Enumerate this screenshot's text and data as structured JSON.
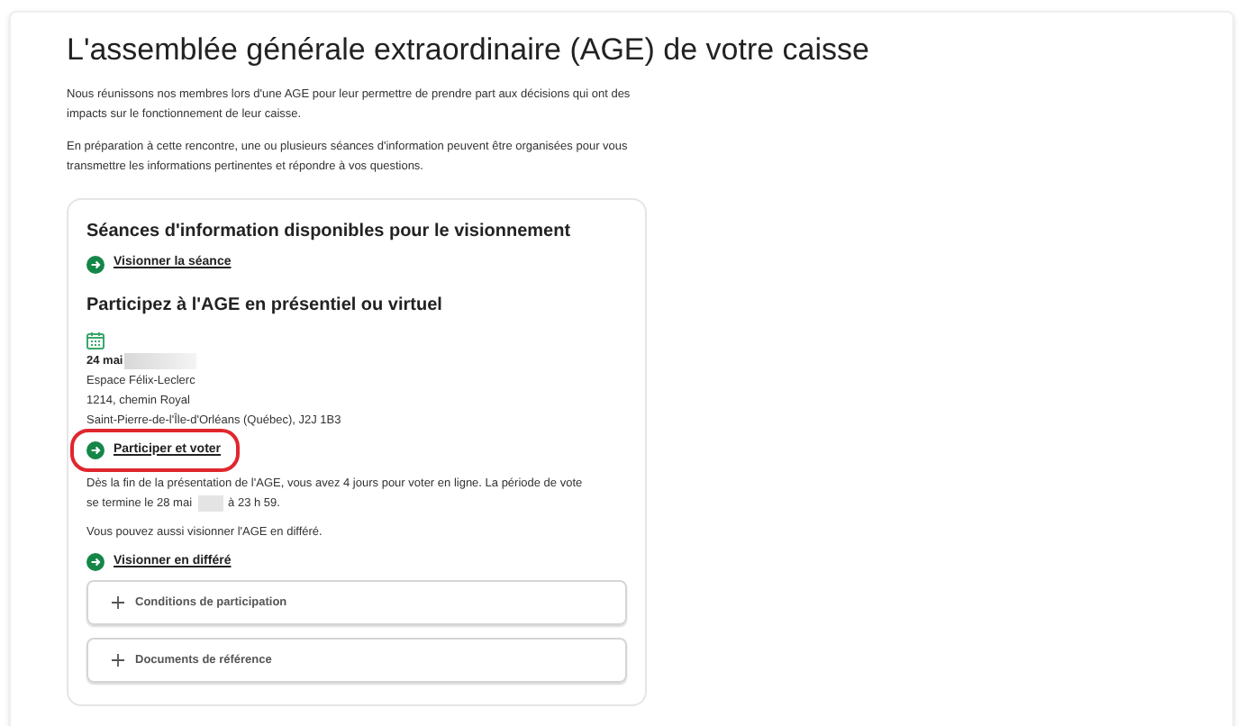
{
  "title": "L'assemblée générale extraordinaire (AGE) de votre caisse",
  "intro": [
    "Nous réunissons nos membres lors d'une AGE pour leur permettre de prendre part aux décisions qui ont des impacts sur le fonctionnement de leur caisse.",
    "En préparation à cette rencontre, une ou plusieurs séances d'information peuvent être organisées pour vous transmettre les informations pertinentes et répondre à vos questions."
  ],
  "card": {
    "section_1": {
      "heading": "Séances d'information disponibles pour le visionnement",
      "link": "Visionner la séance"
    },
    "section_2": {
      "heading": "Participez à l'AGE en présentiel ou virtuel",
      "date": "24 mai",
      "address": [
        "Espace Félix-Leclerc",
        "1214, chemin Royal",
        "Saint-Pierre-de-l'Île-d'Orléans (Québec), J2J 1B3"
      ],
      "link": {
        "label": "Participer et voter",
        "highlighted": true
      },
      "vote_text_line_1": "Dès la fin de la présentation de l'AGE, vous avez 4 jours pour voter en ligne. La période de vote",
      "vote_text_before": "se termine le 28 mai",
      "vote_text_after": "à 23 h 59.",
      "replay_text": "Vous pouvez aussi visionner l'AGE en différé.",
      "replay_link": "Visionner en différé"
    },
    "accordions": [
      {
        "label": "Conditions de participation",
        "expanded": false
      },
      {
        "label": "Documents de référence",
        "expanded": false
      }
    ]
  }
}
